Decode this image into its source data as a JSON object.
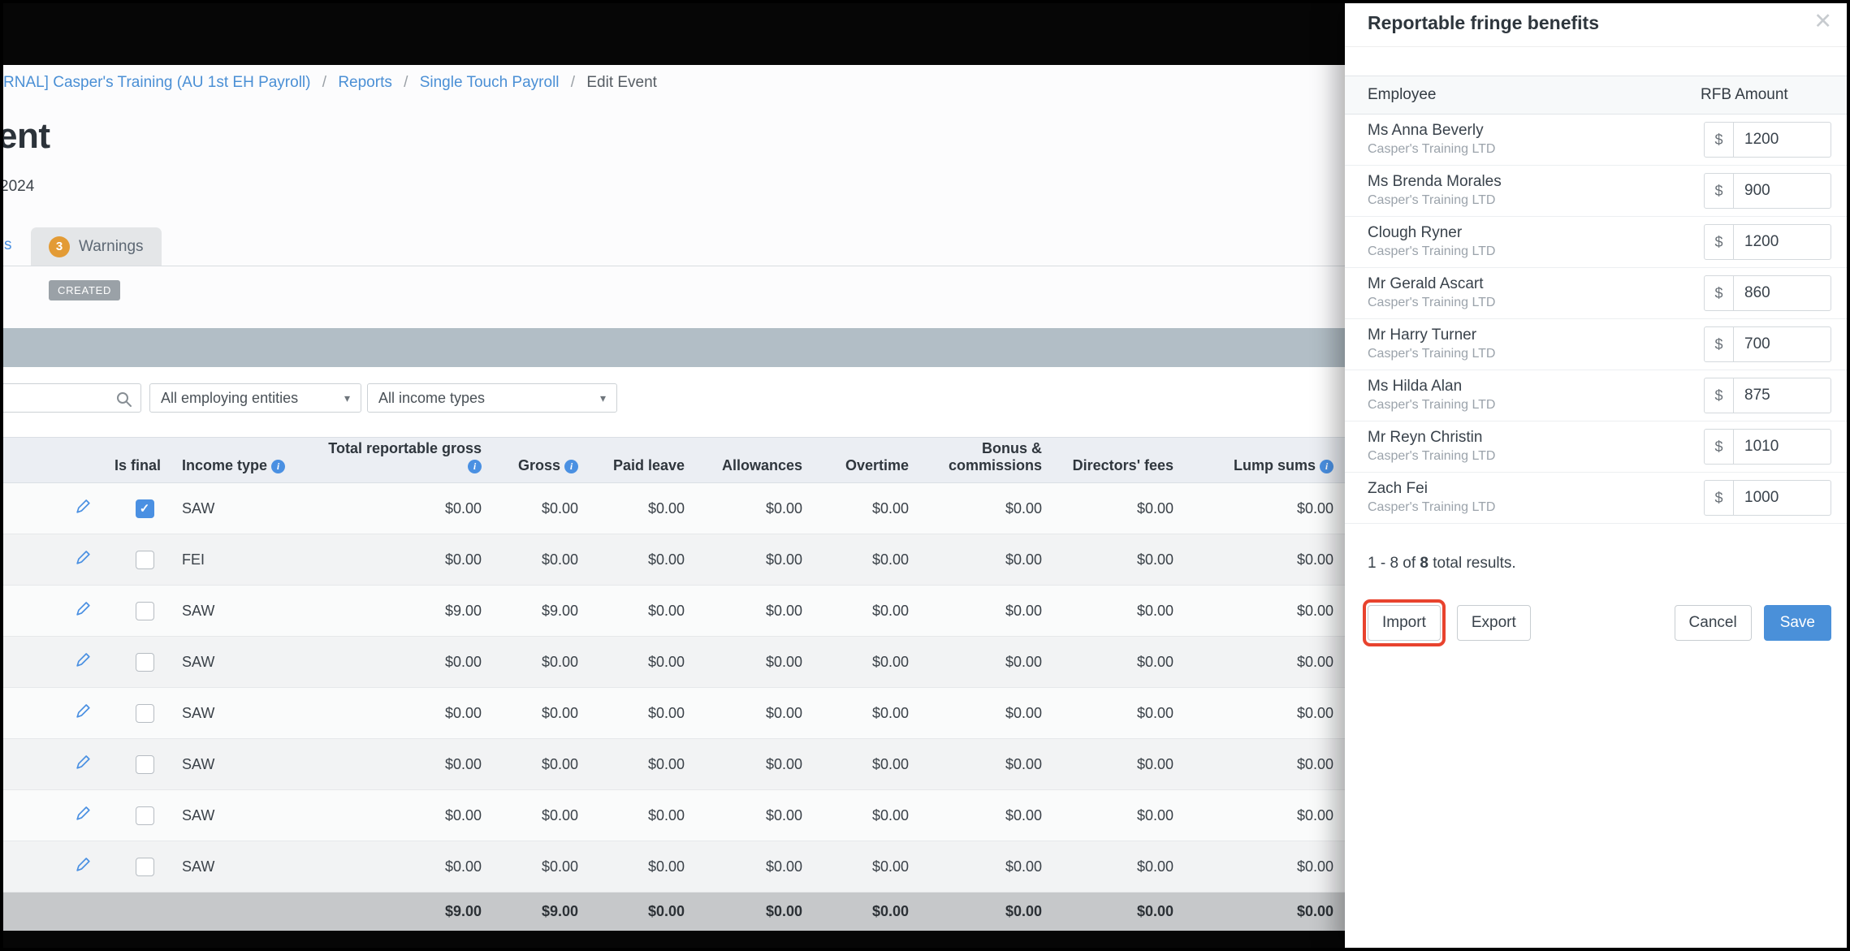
{
  "colors": {
    "accent_blue": "#4a90e2",
    "save_blue": "#4a90d9",
    "warning_orange": "#e39b35",
    "highlight_red": "#e8432e",
    "band_gray": "#b2bec6"
  },
  "icons": {
    "edit": "pencil",
    "search": "magnifier",
    "info": "i",
    "caret": "▾",
    "close": "✕",
    "check": "✓"
  },
  "breadcrumb": {
    "links": [
      "RNAL] Casper's Training (AU 1st EH Payroll)",
      "Reports",
      "Single Touch Payroll"
    ],
    "separator": "/",
    "current": "Edit Event"
  },
  "page": {
    "title_fragment": "ent",
    "subtitle_fragment": "2024",
    "status_badge": "CREATED",
    "partial_tab_fragment": "s",
    "warnings_tab": {
      "count": "3",
      "label": "Warnings"
    }
  },
  "filters": {
    "employing_entities": "All employing entities",
    "income_types": "All income types"
  },
  "table": {
    "headers": {
      "is_final": "Is final",
      "income_type": "Income type",
      "total_reportable_gross": "Total reportable gross",
      "gross": "Gross",
      "paid_leave": "Paid leave",
      "allowances": "Allowances",
      "overtime": "Overtime",
      "bonus_commissions": "Bonus & commissions",
      "directors_fees": "Directors' fees",
      "lump_sums": "Lump sums"
    },
    "rows": [
      {
        "checked": true,
        "income_type": "SAW",
        "values": [
          "$0.00",
          "$0.00",
          "$0.00",
          "$0.00",
          "$0.00",
          "$0.00",
          "$0.00",
          "$0.00"
        ]
      },
      {
        "checked": false,
        "income_type": "FEI",
        "values": [
          "$0.00",
          "$0.00",
          "$0.00",
          "$0.00",
          "$0.00",
          "$0.00",
          "$0.00",
          "$0.00"
        ]
      },
      {
        "checked": false,
        "income_type": "SAW",
        "values": [
          "$9.00",
          "$9.00",
          "$0.00",
          "$0.00",
          "$0.00",
          "$0.00",
          "$0.00",
          "$0.00"
        ]
      },
      {
        "checked": false,
        "income_type": "SAW",
        "values": [
          "$0.00",
          "$0.00",
          "$0.00",
          "$0.00",
          "$0.00",
          "$0.00",
          "$0.00",
          "$0.00"
        ]
      },
      {
        "checked": false,
        "income_type": "SAW",
        "values": [
          "$0.00",
          "$0.00",
          "$0.00",
          "$0.00",
          "$0.00",
          "$0.00",
          "$0.00",
          "$0.00"
        ]
      },
      {
        "checked": false,
        "income_type": "SAW",
        "values": [
          "$0.00",
          "$0.00",
          "$0.00",
          "$0.00",
          "$0.00",
          "$0.00",
          "$0.00",
          "$0.00"
        ]
      },
      {
        "checked": false,
        "income_type": "SAW",
        "values": [
          "$0.00",
          "$0.00",
          "$0.00",
          "$0.00",
          "$0.00",
          "$0.00",
          "$0.00",
          "$0.00"
        ]
      },
      {
        "checked": false,
        "income_type": "SAW",
        "values": [
          "$0.00",
          "$0.00",
          "$0.00",
          "$0.00",
          "$0.00",
          "$0.00",
          "$0.00",
          "$0.00"
        ]
      }
    ],
    "totals": [
      "$9.00",
      "$9.00",
      "$0.00",
      "$0.00",
      "$0.00",
      "$0.00",
      "$0.00",
      "$0.00"
    ]
  },
  "drawer": {
    "title": "Reportable fringe benefits",
    "close_label": "✕",
    "col_employee": "Employee",
    "col_amount": "RFB Amount",
    "currency_symbol": "$",
    "rows": [
      {
        "name": "Ms Anna Beverly",
        "company": "Casper's Training LTD",
        "amount": "1200"
      },
      {
        "name": "Ms Brenda Morales",
        "company": "Casper's Training LTD",
        "amount": "900"
      },
      {
        "name": "Clough Ryner",
        "company": "Casper's Training LTD",
        "amount": "1200"
      },
      {
        "name": "Mr Gerald Ascart",
        "company": "Casper's Training LTD",
        "amount": "860"
      },
      {
        "name": "Mr Harry Turner",
        "company": "Casper's Training LTD",
        "amount": "700"
      },
      {
        "name": "Ms Hilda Alan",
        "company": "Casper's Training LTD",
        "amount": "875"
      },
      {
        "name": "Mr Reyn Christin",
        "company": "Casper's Training LTD",
        "amount": "1010"
      },
      {
        "name": "Zach Fei",
        "company": "Casper's Training LTD",
        "amount": "1000"
      }
    ],
    "results": {
      "prefix": "1 - 8 of ",
      "total": "8",
      "suffix": " total results."
    },
    "buttons": {
      "import": "Import",
      "export": "Export",
      "cancel": "Cancel",
      "save": "Save"
    }
  }
}
